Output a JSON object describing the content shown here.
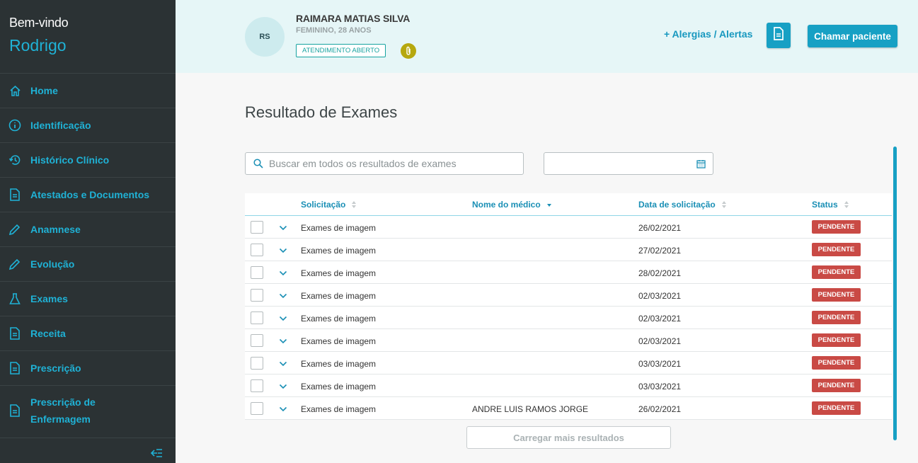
{
  "sidebar": {
    "welcome": "Bem-vindo",
    "user": "Rodrigo",
    "items": [
      {
        "label": "Home",
        "icon": "home-icon"
      },
      {
        "label": "Identificação",
        "icon": "info-icon"
      },
      {
        "label": "Histórico Clínico",
        "icon": "history-icon"
      },
      {
        "label": "Atestados e Documentos",
        "icon": "document-icon"
      },
      {
        "label": "Anamnese",
        "icon": "pencil-icon"
      },
      {
        "label": "Evolução",
        "icon": "pencil-icon"
      },
      {
        "label": "Exames",
        "icon": "flask-icon"
      },
      {
        "label": "Receita",
        "icon": "document-icon"
      },
      {
        "label": "Prescrição",
        "icon": "document-icon"
      },
      {
        "label": "Prescrição de Enfermagem",
        "icon": "document-icon"
      }
    ]
  },
  "header": {
    "initials": "RS",
    "patient_name": "RAIMARA MATIAS SILVA",
    "patient_info": "FEMININO, 28 ANOS",
    "status_badge": "ATENDIMENTO ABERTO",
    "allergies_link": "+ Alergias / Alertas",
    "call_button": "Chamar paciente"
  },
  "main": {
    "title": "Resultado de Exames",
    "search_placeholder": "Buscar em todos os resultados de exames",
    "load_more": "Carregar mais resultados",
    "columns": {
      "solicitacao": "Solicitação",
      "medico": "Nome do médico",
      "data": "Data de solicitação",
      "status": "Status"
    },
    "rows": [
      {
        "solicitacao": "Exames de imagem",
        "medico": "",
        "data": "26/02/2021",
        "status": "PENDENTE"
      },
      {
        "solicitacao": "Exames de imagem",
        "medico": "",
        "data": "27/02/2021",
        "status": "PENDENTE"
      },
      {
        "solicitacao": "Exames de imagem",
        "medico": "",
        "data": "28/02/2021",
        "status": "PENDENTE"
      },
      {
        "solicitacao": "Exames de imagem",
        "medico": "",
        "data": "02/03/2021",
        "status": "PENDENTE"
      },
      {
        "solicitacao": "Exames de imagem",
        "medico": "",
        "data": "02/03/2021",
        "status": "PENDENTE"
      },
      {
        "solicitacao": "Exames de imagem",
        "medico": "",
        "data": "02/03/2021",
        "status": "PENDENTE"
      },
      {
        "solicitacao": "Exames de imagem",
        "medico": "",
        "data": "03/03/2021",
        "status": "PENDENTE"
      },
      {
        "solicitacao": "Exames de imagem",
        "medico": "",
        "data": "03/03/2021",
        "status": "PENDENTE"
      },
      {
        "solicitacao": "Exames de imagem",
        "medico": "ANDRE LUIS RAMOS JORGE",
        "data": "26/02/2021",
        "status": "PENDENTE"
      }
    ]
  },
  "colors": {
    "accent": "#1fb2d6",
    "sidebar_bg": "#2b3234",
    "header_bg": "#e6f6f7",
    "status_pending": "#c94a45",
    "primary_button": "#17a0c4"
  }
}
